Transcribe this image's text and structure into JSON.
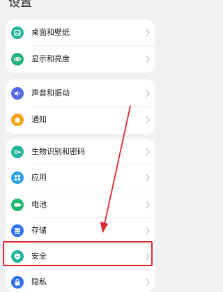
{
  "header": {
    "title": "设置"
  },
  "groups": [
    {
      "items": [
        {
          "label": "桌面和壁纸",
          "icon": "wallpaper-icon",
          "color": "#27b59a"
        },
        {
          "label": "显示和亮度",
          "icon": "eye-icon",
          "color": "#1fb27c"
        }
      ]
    },
    {
      "items": [
        {
          "label": "声音和振动",
          "icon": "volume-icon",
          "color": "#5469e6"
        },
        {
          "label": "通知",
          "icon": "bell-icon",
          "color": "#f3a416"
        }
      ]
    },
    {
      "items": [
        {
          "label": "生物识别和密码",
          "icon": "key-icon",
          "color": "#25b49b"
        },
        {
          "label": "应用",
          "icon": "apps-icon",
          "color": "#2b9ff0"
        },
        {
          "label": "电池",
          "icon": "battery-icon",
          "color": "#1db86e"
        },
        {
          "label": "存储",
          "icon": "storage-icon",
          "color": "#2f6ff0"
        },
        {
          "label": "安全",
          "icon": "shield-icon",
          "color": "#24b49e"
        },
        {
          "label": "隐私",
          "icon": "lock-icon",
          "color": "#2f6ff0"
        }
      ]
    }
  ],
  "annotations": {
    "highlight_color": "#e0282e",
    "highlighted_item": "安全"
  }
}
